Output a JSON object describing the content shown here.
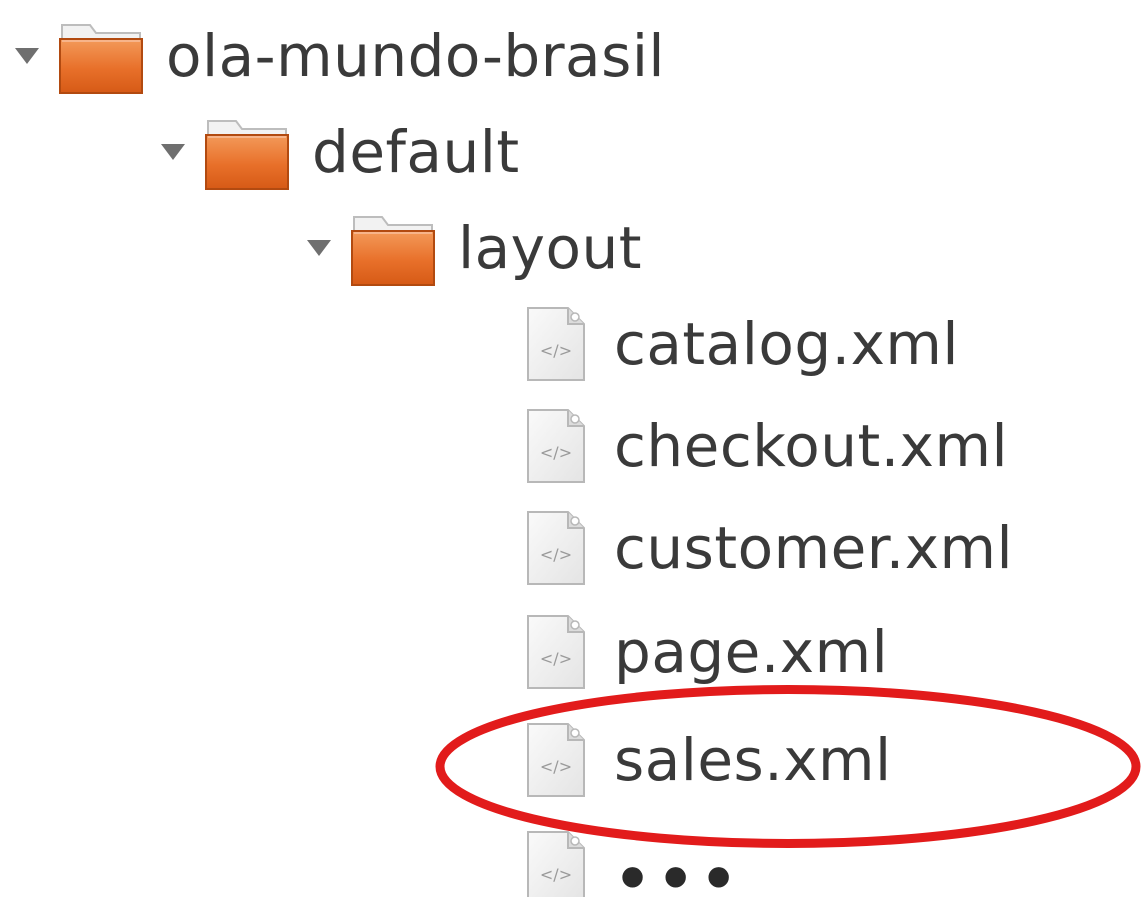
{
  "tree": {
    "root": {
      "label": "ola-mundo-brasil",
      "icon": "folder-icon",
      "expanded": true
    },
    "child": {
      "label": "default",
      "icon": "folder-icon",
      "expanded": true
    },
    "grandchild": {
      "label": "layout",
      "icon": "folder-icon",
      "expanded": true
    },
    "files": [
      {
        "label": "catalog.xml",
        "icon": "xml-file-icon"
      },
      {
        "label": "checkout.xml",
        "icon": "xml-file-icon"
      },
      {
        "label": "customer.xml",
        "icon": "xml-file-icon"
      },
      {
        "label": "page.xml",
        "icon": "xml-file-icon"
      },
      {
        "label": "sales.xml",
        "icon": "xml-file-icon",
        "highlighted": true
      }
    ],
    "more_label": "•••"
  },
  "colors": {
    "folder_orange": "#e8702a",
    "highlight_red": "#e21b1b",
    "text": "#3a3a3a",
    "arrow": "#6f6f6f"
  }
}
